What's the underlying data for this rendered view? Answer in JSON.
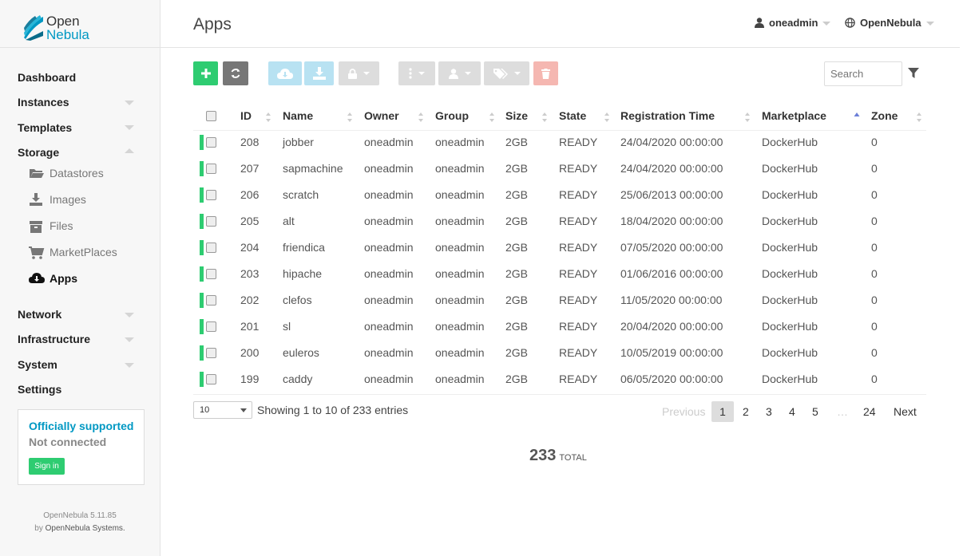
{
  "brand": {
    "line1": "Open",
    "line2": "Nebula"
  },
  "sidebar": {
    "nav": [
      {
        "label": "Dashboard"
      },
      {
        "label": "Instances"
      },
      {
        "label": "Templates"
      },
      {
        "label": "Storage"
      },
      {
        "label": "Network"
      },
      {
        "label": "Infrastructure"
      },
      {
        "label": "System"
      },
      {
        "label": "Settings"
      }
    ],
    "storage_items": [
      {
        "label": "Datastores",
        "icon": "folder-icon"
      },
      {
        "label": "Images",
        "icon": "download-icon"
      },
      {
        "label": "Files",
        "icon": "archive-icon"
      },
      {
        "label": "MarketPlaces",
        "icon": "cart-icon"
      },
      {
        "label": "Apps",
        "icon": "cloud-download-icon"
      }
    ],
    "support": {
      "title": "Officially supported",
      "status": "Not connected",
      "signin": "Sign in"
    },
    "version": {
      "line1": "OpenNebula 5.11.85",
      "line2_prefix": "by ",
      "line2_link": "OpenNebula Systems."
    }
  },
  "header": {
    "title": "Apps",
    "user": "oneadmin",
    "zone": "OpenNebula"
  },
  "search": {
    "placeholder": "Search"
  },
  "table": {
    "columns": [
      "ID",
      "Name",
      "Owner",
      "Group",
      "Size",
      "State",
      "Registration Time",
      "Marketplace",
      "Zone"
    ],
    "rows": [
      {
        "id": "208",
        "name": "jobber",
        "owner": "oneadmin",
        "group": "oneadmin",
        "size": "2GB",
        "state": "READY",
        "time": "24/04/2020 00:00:00",
        "market": "DockerHub",
        "zone": "0"
      },
      {
        "id": "207",
        "name": "sapmachine",
        "owner": "oneadmin",
        "group": "oneadmin",
        "size": "2GB",
        "state": "READY",
        "time": "24/04/2020 00:00:00",
        "market": "DockerHub",
        "zone": "0"
      },
      {
        "id": "206",
        "name": "scratch",
        "owner": "oneadmin",
        "group": "oneadmin",
        "size": "2GB",
        "state": "READY",
        "time": "25/06/2013 00:00:00",
        "market": "DockerHub",
        "zone": "0"
      },
      {
        "id": "205",
        "name": "alt",
        "owner": "oneadmin",
        "group": "oneadmin",
        "size": "2GB",
        "state": "READY",
        "time": "18/04/2020 00:00:00",
        "market": "DockerHub",
        "zone": "0"
      },
      {
        "id": "204",
        "name": "friendica",
        "owner": "oneadmin",
        "group": "oneadmin",
        "size": "2GB",
        "state": "READY",
        "time": "07/05/2020 00:00:00",
        "market": "DockerHub",
        "zone": "0"
      },
      {
        "id": "203",
        "name": "hipache",
        "owner": "oneadmin",
        "group": "oneadmin",
        "size": "2GB",
        "state": "READY",
        "time": "01/06/2016 00:00:00",
        "market": "DockerHub",
        "zone": "0"
      },
      {
        "id": "202",
        "name": "clefos",
        "owner": "oneadmin",
        "group": "oneadmin",
        "size": "2GB",
        "state": "READY",
        "time": "11/05/2020 00:00:00",
        "market": "DockerHub",
        "zone": "0"
      },
      {
        "id": "201",
        "name": "sl",
        "owner": "oneadmin",
        "group": "oneadmin",
        "size": "2GB",
        "state": "READY",
        "time": "20/04/2020 00:00:00",
        "market": "DockerHub",
        "zone": "0"
      },
      {
        "id": "200",
        "name": "euleros",
        "owner": "oneadmin",
        "group": "oneadmin",
        "size": "2GB",
        "state": "READY",
        "time": "10/05/2019 00:00:00",
        "market": "DockerHub",
        "zone": "0"
      },
      {
        "id": "199",
        "name": "caddy",
        "owner": "oneadmin",
        "group": "oneadmin",
        "size": "2GB",
        "state": "READY",
        "time": "06/05/2020 00:00:00",
        "market": "DockerHub",
        "zone": "0"
      }
    ]
  },
  "footer": {
    "page_length": "10",
    "info": "Showing 1 to 10 of 233 entries",
    "pagination": {
      "previous": "Previous",
      "pages": [
        "1",
        "2",
        "3",
        "4",
        "5"
      ],
      "ellipsis": "…",
      "last": "24",
      "next": "Next"
    },
    "total_value": "233",
    "total_label": "TOTAL"
  }
}
